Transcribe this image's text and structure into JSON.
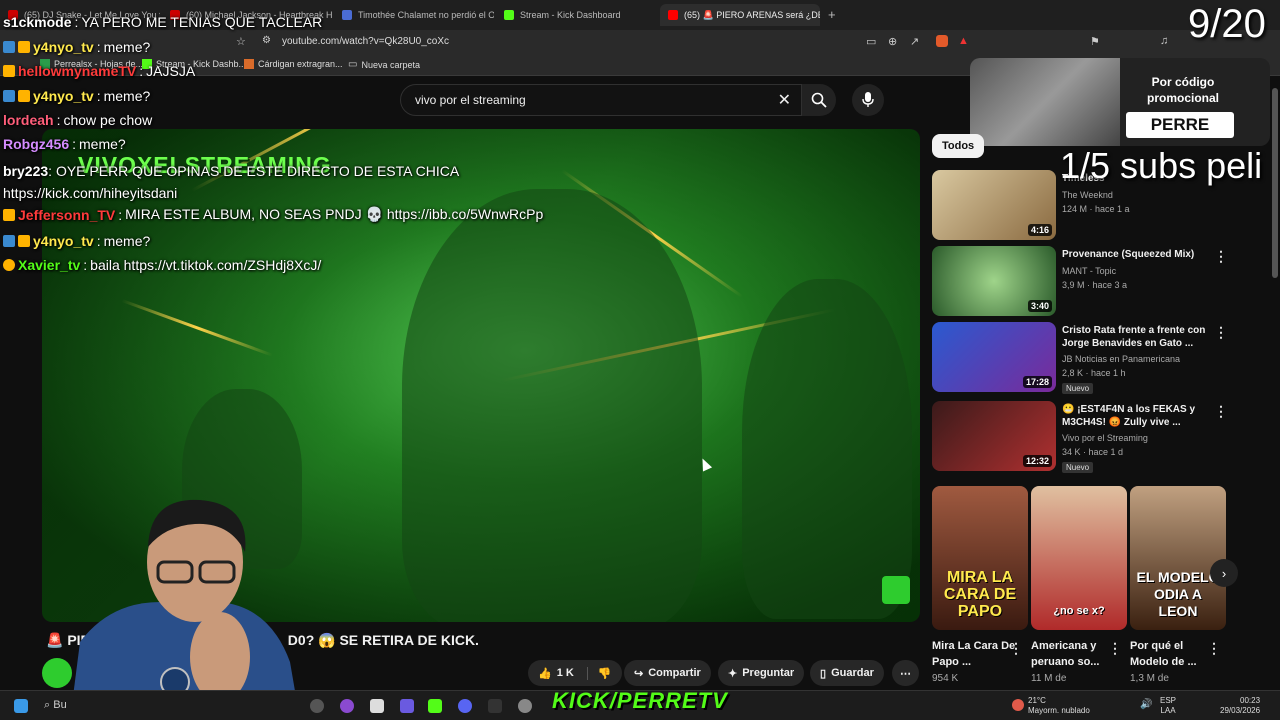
{
  "browser": {
    "tabs": [
      {
        "label": "(65) DJ Snake - Let Me Love You ft.",
        "color": "#cc0000"
      },
      {
        "label": "(60) Michael Jackson - Heartbreak Ho",
        "color": "#cc0000"
      },
      {
        "label": "Timothée Chalamet no perdió el Osc",
        "color": "#4a6cd4"
      },
      {
        "label": "Stream - Kick Dashboard",
        "color": "#53fc18"
      },
      {
        "label": "(65) 🚨 PIERO ARENAS será ¿DE",
        "color": "#ff0000"
      }
    ],
    "url": "youtube.com/watch?v=Qk28U0_coXc",
    "bookmarks": [
      "Perrealsx - Hojas de...",
      "Stream - Kick Dashb...",
      "Cárdigan extragran...",
      "Nueva carpeta"
    ]
  },
  "youtube": {
    "search_query": "vivo por el streaming",
    "video_title": "PIERO ARENAS será ¿DEJA O VUELVE KICK? EL INFLUENCER COBRA 900K EN 2 DÍAS 🤯 SE RETIRA DE KICK.",
    "video_title_visible_left": "PIER",
    "video_title_visible_right": "D0? 😱 SE RETIRA DE KICK.",
    "overlay_title": "VIVOXELSTREAMING",
    "actions": {
      "likes": "1 K",
      "share": "Compartir",
      "ask": "Preguntar",
      "save": "Guardar"
    },
    "filter_chip": "Todos",
    "recommendations": [
      {
        "title": "Timeless",
        "channel": "The Weeknd",
        "meta": "124 M · hace 1 a",
        "duration": "4:16",
        "thumb": "#c9b48a",
        "badge": ""
      },
      {
        "title": "Provenance (Squeezed Mix)",
        "channel": "MANT - Topic",
        "meta": "3,9 M · hace 3 a",
        "duration": "3:40",
        "thumb": "#3a7a3a",
        "badge": ""
      },
      {
        "title": "Cristo Rata frente a frente con Jorge Benavides en Gato ...",
        "channel": "JB Noticias en Panamericana",
        "meta": "2,8 K · hace 1 h",
        "duration": "17:28",
        "thumb": "#1f4fb0",
        "badge": "Nuevo"
      },
      {
        "title": "😬 ¡EST4F4N a los FEKAS y M3CH4S! 😡 Zully vive ...",
        "channel": "Vivo por el Streaming",
        "meta": "34 K · hace 1 d",
        "duration": "12:32",
        "thumb": "#7a2020",
        "badge": "Nuevo"
      }
    ],
    "shorts": [
      {
        "overlay": "MIRA LA CARA DE PAPO",
        "title": "Mira La Cara De Papo ...",
        "views": "954 K",
        "color": "#6b3a2a"
      },
      {
        "overlay": "¿no se x?",
        "title": "Americana y peruano so...",
        "views": "11 M de",
        "color": "#b02a2a"
      },
      {
        "overlay": "EL MODELO ODIA A LEON",
        "title": "Por qué el Modelo de ...",
        "views": "1,3 M de",
        "color": "#4a3020"
      }
    ]
  },
  "promo": {
    "label": "Por código promocional",
    "code": "PERRE"
  },
  "overlay": {
    "counter": "9/20",
    "subs_goal": "1/5 subs peli"
  },
  "chat": [
    {
      "user": "s1ckmode",
      "text": "YA PERO ME TENIAS QUE TACLEAR",
      "color": "#ffffff"
    },
    {
      "user": "y4nyo_tv",
      "text": "meme?",
      "color": "#ffe94d"
    },
    {
      "user": "hellowmynameTV",
      "text": "JAJSJA",
      "color": "#ff3b3b"
    },
    {
      "user": "y4nyo_tv",
      "text": "meme?",
      "color": "#ffe94d"
    },
    {
      "user": "lordeah",
      "text": "chow pe chow",
      "color": "#ff5e7a"
    },
    {
      "user": "Robgz456",
      "text": "meme?",
      "color": "#d58cff"
    },
    {
      "user": "bry223",
      "text": "OYE PERR QUE OPINAS DE ESTE DIRECTO DE ESTA CHICA https://kick.com/hiheyitsdani",
      "color": "#ffffff"
    },
    {
      "user": "Jeffersonn_TV",
      "text": "MIRA ESTE ALBUM, NO SEAS PNDJ 💀 https://ibb.co/5WnwRcPp",
      "color": "#ff3b3b"
    },
    {
      "user": "y4nyo_tv",
      "text": "meme?",
      "color": "#ffe94d"
    },
    {
      "user": "Xavier_tv",
      "text": "baila https://vt.tiktok.com/ZSHdj8XcJ/",
      "color": "#53fc18"
    }
  ],
  "taskbar": {
    "brand": "KICK/PERRETV",
    "weather_temp": "21°C",
    "weather_desc": "Mayorm. nublado",
    "lang_1": "ESP",
    "lang_2": "LAA",
    "time": "00:23",
    "date": "29/03/2026",
    "search": "Bu"
  }
}
